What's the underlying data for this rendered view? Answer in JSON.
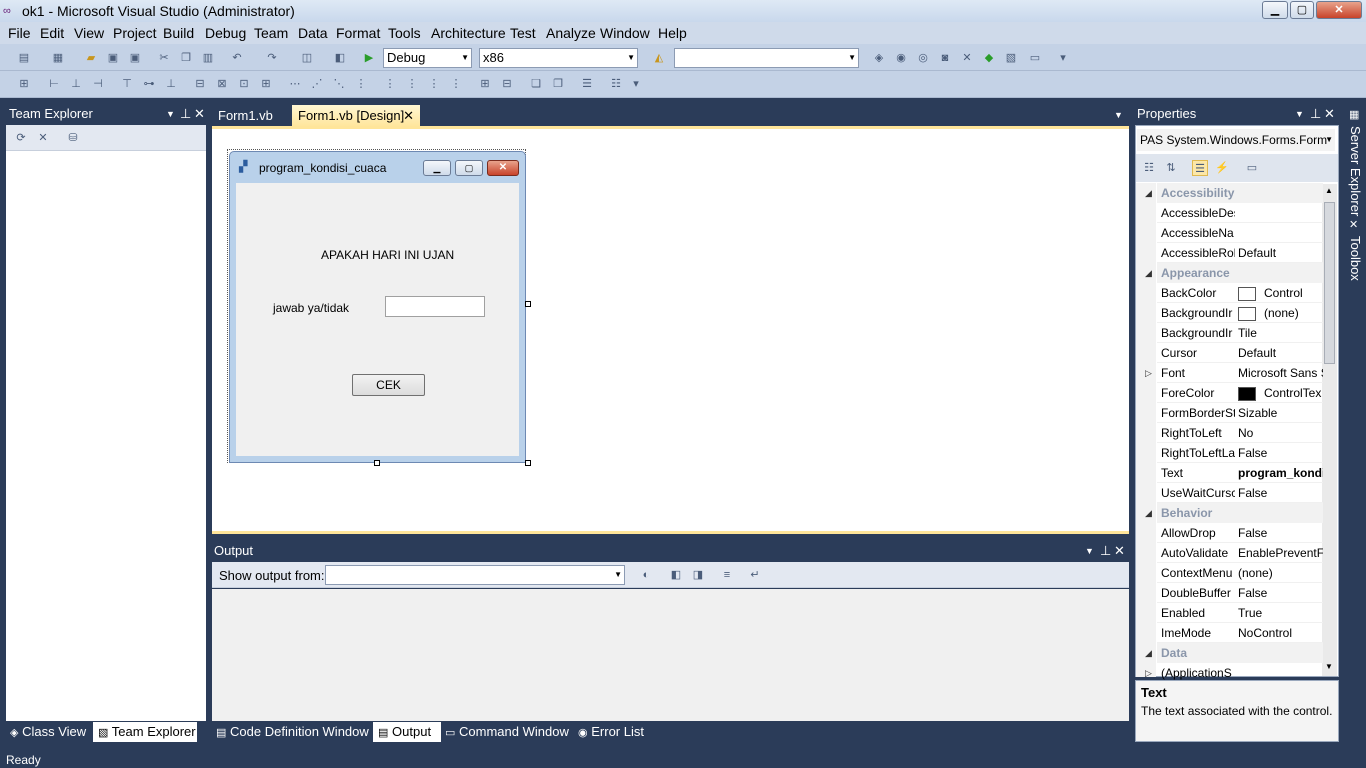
{
  "window": {
    "title": "ok1 - Microsoft Visual Studio (Administrator)"
  },
  "menu": [
    "File",
    "Edit",
    "View",
    "Project",
    "Build",
    "Debug",
    "Team",
    "Data",
    "Format",
    "Tools",
    "Architecture",
    "Test",
    "Analyze",
    "Window",
    "Help"
  ],
  "toolbar": {
    "config": "Debug",
    "platform": "x86",
    "find": ""
  },
  "team_explorer": {
    "title": "Team Explorer"
  },
  "doc_tabs": {
    "tab1": "Form1.vb",
    "tab2": "Form1.vb [Design]"
  },
  "form": {
    "title": "program_kondisi_cuaca",
    "label1": "APAKAH HARI INI UJAN",
    "label2": "jawab ya/tidak",
    "textbox": "",
    "button": "CEK"
  },
  "output": {
    "title": "Output",
    "show_label": "Show output from:",
    "source": ""
  },
  "properties": {
    "title": "Properties",
    "object": "PAS System.Windows.Forms.Form",
    "rows": [
      {
        "name": "Accessibility",
        "value": "",
        "cat": true
      },
      {
        "name": "AccessibleDes",
        "value": ""
      },
      {
        "name": "AccessibleNa",
        "value": ""
      },
      {
        "name": "AccessibleRol",
        "value": "Default"
      },
      {
        "name": "Appearance",
        "value": "",
        "cat": true
      },
      {
        "name": "BackColor",
        "value": "Control",
        "swatch": "#ffffff"
      },
      {
        "name": "BackgroundIr",
        "value": "(none)",
        "swatch": "#ffffff"
      },
      {
        "name": "BackgroundIr",
        "value": "Tile"
      },
      {
        "name": "Cursor",
        "value": "Default"
      },
      {
        "name": "Font",
        "value": "Microsoft Sans S"
      },
      {
        "name": "ForeColor",
        "value": "ControlTex",
        "swatch": "#000000"
      },
      {
        "name": "FormBorderSt",
        "value": "Sizable"
      },
      {
        "name": "RightToLeft",
        "value": "No"
      },
      {
        "name": "RightToLeftLa",
        "value": "False"
      },
      {
        "name": "Text",
        "value": "program_kondi",
        "bold": true
      },
      {
        "name": "UseWaitCursc",
        "value": "False"
      },
      {
        "name": "Behavior",
        "value": "",
        "cat": true
      },
      {
        "name": "AllowDrop",
        "value": "False"
      },
      {
        "name": "AutoValidate",
        "value": "EnablePreventFc"
      },
      {
        "name": "ContextMenu",
        "value": "(none)"
      },
      {
        "name": "DoubleBuffer",
        "value": "False"
      },
      {
        "name": "Enabled",
        "value": "True"
      },
      {
        "name": "ImeMode",
        "value": "NoControl"
      },
      {
        "name": "Data",
        "value": "",
        "cat": true
      },
      {
        "name": "(ApplicationS",
        "value": ""
      }
    ],
    "desc_title": "Text",
    "desc_body": "The text associated with the control."
  },
  "side_tabs": {
    "server": "Server Explorer",
    "toolbox": "Toolbox"
  },
  "bottom_tabs": {
    "class_view": "Class View",
    "team_explorer": "Team Explorer",
    "code_def": "Code Definition Window",
    "output": "Output",
    "command": "Command Window",
    "errors": "Error List"
  },
  "status": "Ready"
}
